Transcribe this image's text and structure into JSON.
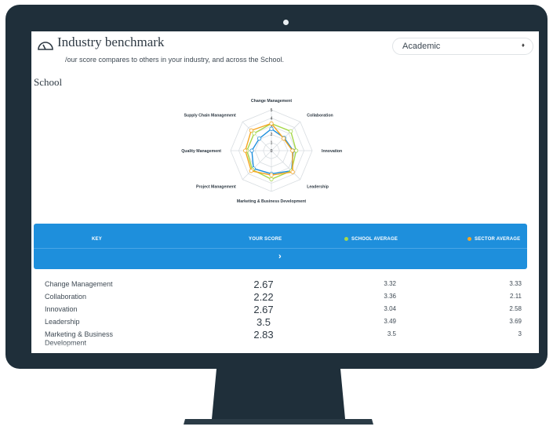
{
  "header": {
    "title": "Industry benchmark",
    "subtitle": "/our score compares to others in your industry, and across the School.",
    "select_value": "Academic",
    "select_caret": "♦"
  },
  "section_title": "School",
  "chart_data": {
    "type": "radar",
    "axes": [
      "Change Management",
      "Collaboration",
      "Innovation",
      "Leadership",
      "Marketing & Business Development",
      "Project Management",
      "Quality Management",
      "Supply Chain Management"
    ],
    "ticks": [
      "0",
      "1",
      "2",
      "3",
      "4",
      "5"
    ],
    "rlim": [
      0,
      5
    ],
    "series": [
      {
        "name": "YOUR SCORE",
        "color": "#1e8fdc",
        "values": [
          2.67,
          2.22,
          2.67,
          3.5,
          2.83,
          3.1,
          2.4,
          2.1
        ]
      },
      {
        "name": "SCHOOL AVERAGE",
        "color": "#a6d84a",
        "values": [
          3.32,
          3.36,
          3.04,
          3.49,
          3.5,
          3.3,
          3.0,
          3.0
        ]
      },
      {
        "name": "SECTOR AVERAGE",
        "color": "#f5a623",
        "values": [
          3.33,
          2.11,
          2.58,
          3.69,
          3.0,
          3.5,
          3.2,
          3.5
        ]
      }
    ]
  },
  "key": {
    "label": "KEY",
    "your_score": "YOUR SCORE",
    "school_average": "SCHOOL AVERAGE",
    "sector_average": "SECTOR AVERAGE",
    "arrow": "›",
    "school_color": "#a6d84a",
    "sector_color": "#f5a623"
  },
  "rows": [
    {
      "label": "Change Management",
      "yours": "2.67",
      "school": "3.32",
      "sector": "3.33"
    },
    {
      "label": "Collaboration",
      "yours": "2.22",
      "school": "3.36",
      "sector": "2.11"
    },
    {
      "label": "Innovation",
      "yours": "2.67",
      "school": "3.04",
      "sector": "2.58"
    },
    {
      "label": "Leadership",
      "yours": "3.5",
      "school": "3.49",
      "sector": "3.69"
    },
    {
      "label": "Marketing & Business Development",
      "yours": "2.83",
      "school": "3.5",
      "sector": "3"
    }
  ]
}
